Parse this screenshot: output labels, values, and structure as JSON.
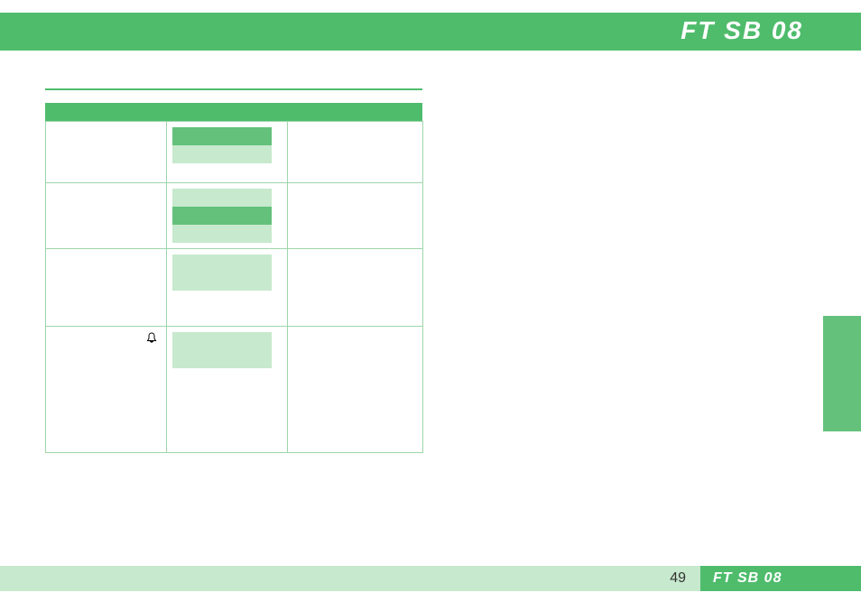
{
  "header": {
    "title": "FT SB 08"
  },
  "footer": {
    "page_number": "49",
    "label": "FT SB 08"
  },
  "icons": {
    "bell": "🔔"
  },
  "table": {
    "rows": [
      {
        "chips": [
          "dark",
          "light"
        ],
        "icon": null
      },
      {
        "chips": [
          "light",
          "dark",
          "light"
        ],
        "icon": null
      },
      {
        "chips": [
          "light",
          "light"
        ],
        "icon": null
      },
      {
        "chips": [
          "light",
          "light"
        ],
        "icon": "bell"
      }
    ]
  }
}
